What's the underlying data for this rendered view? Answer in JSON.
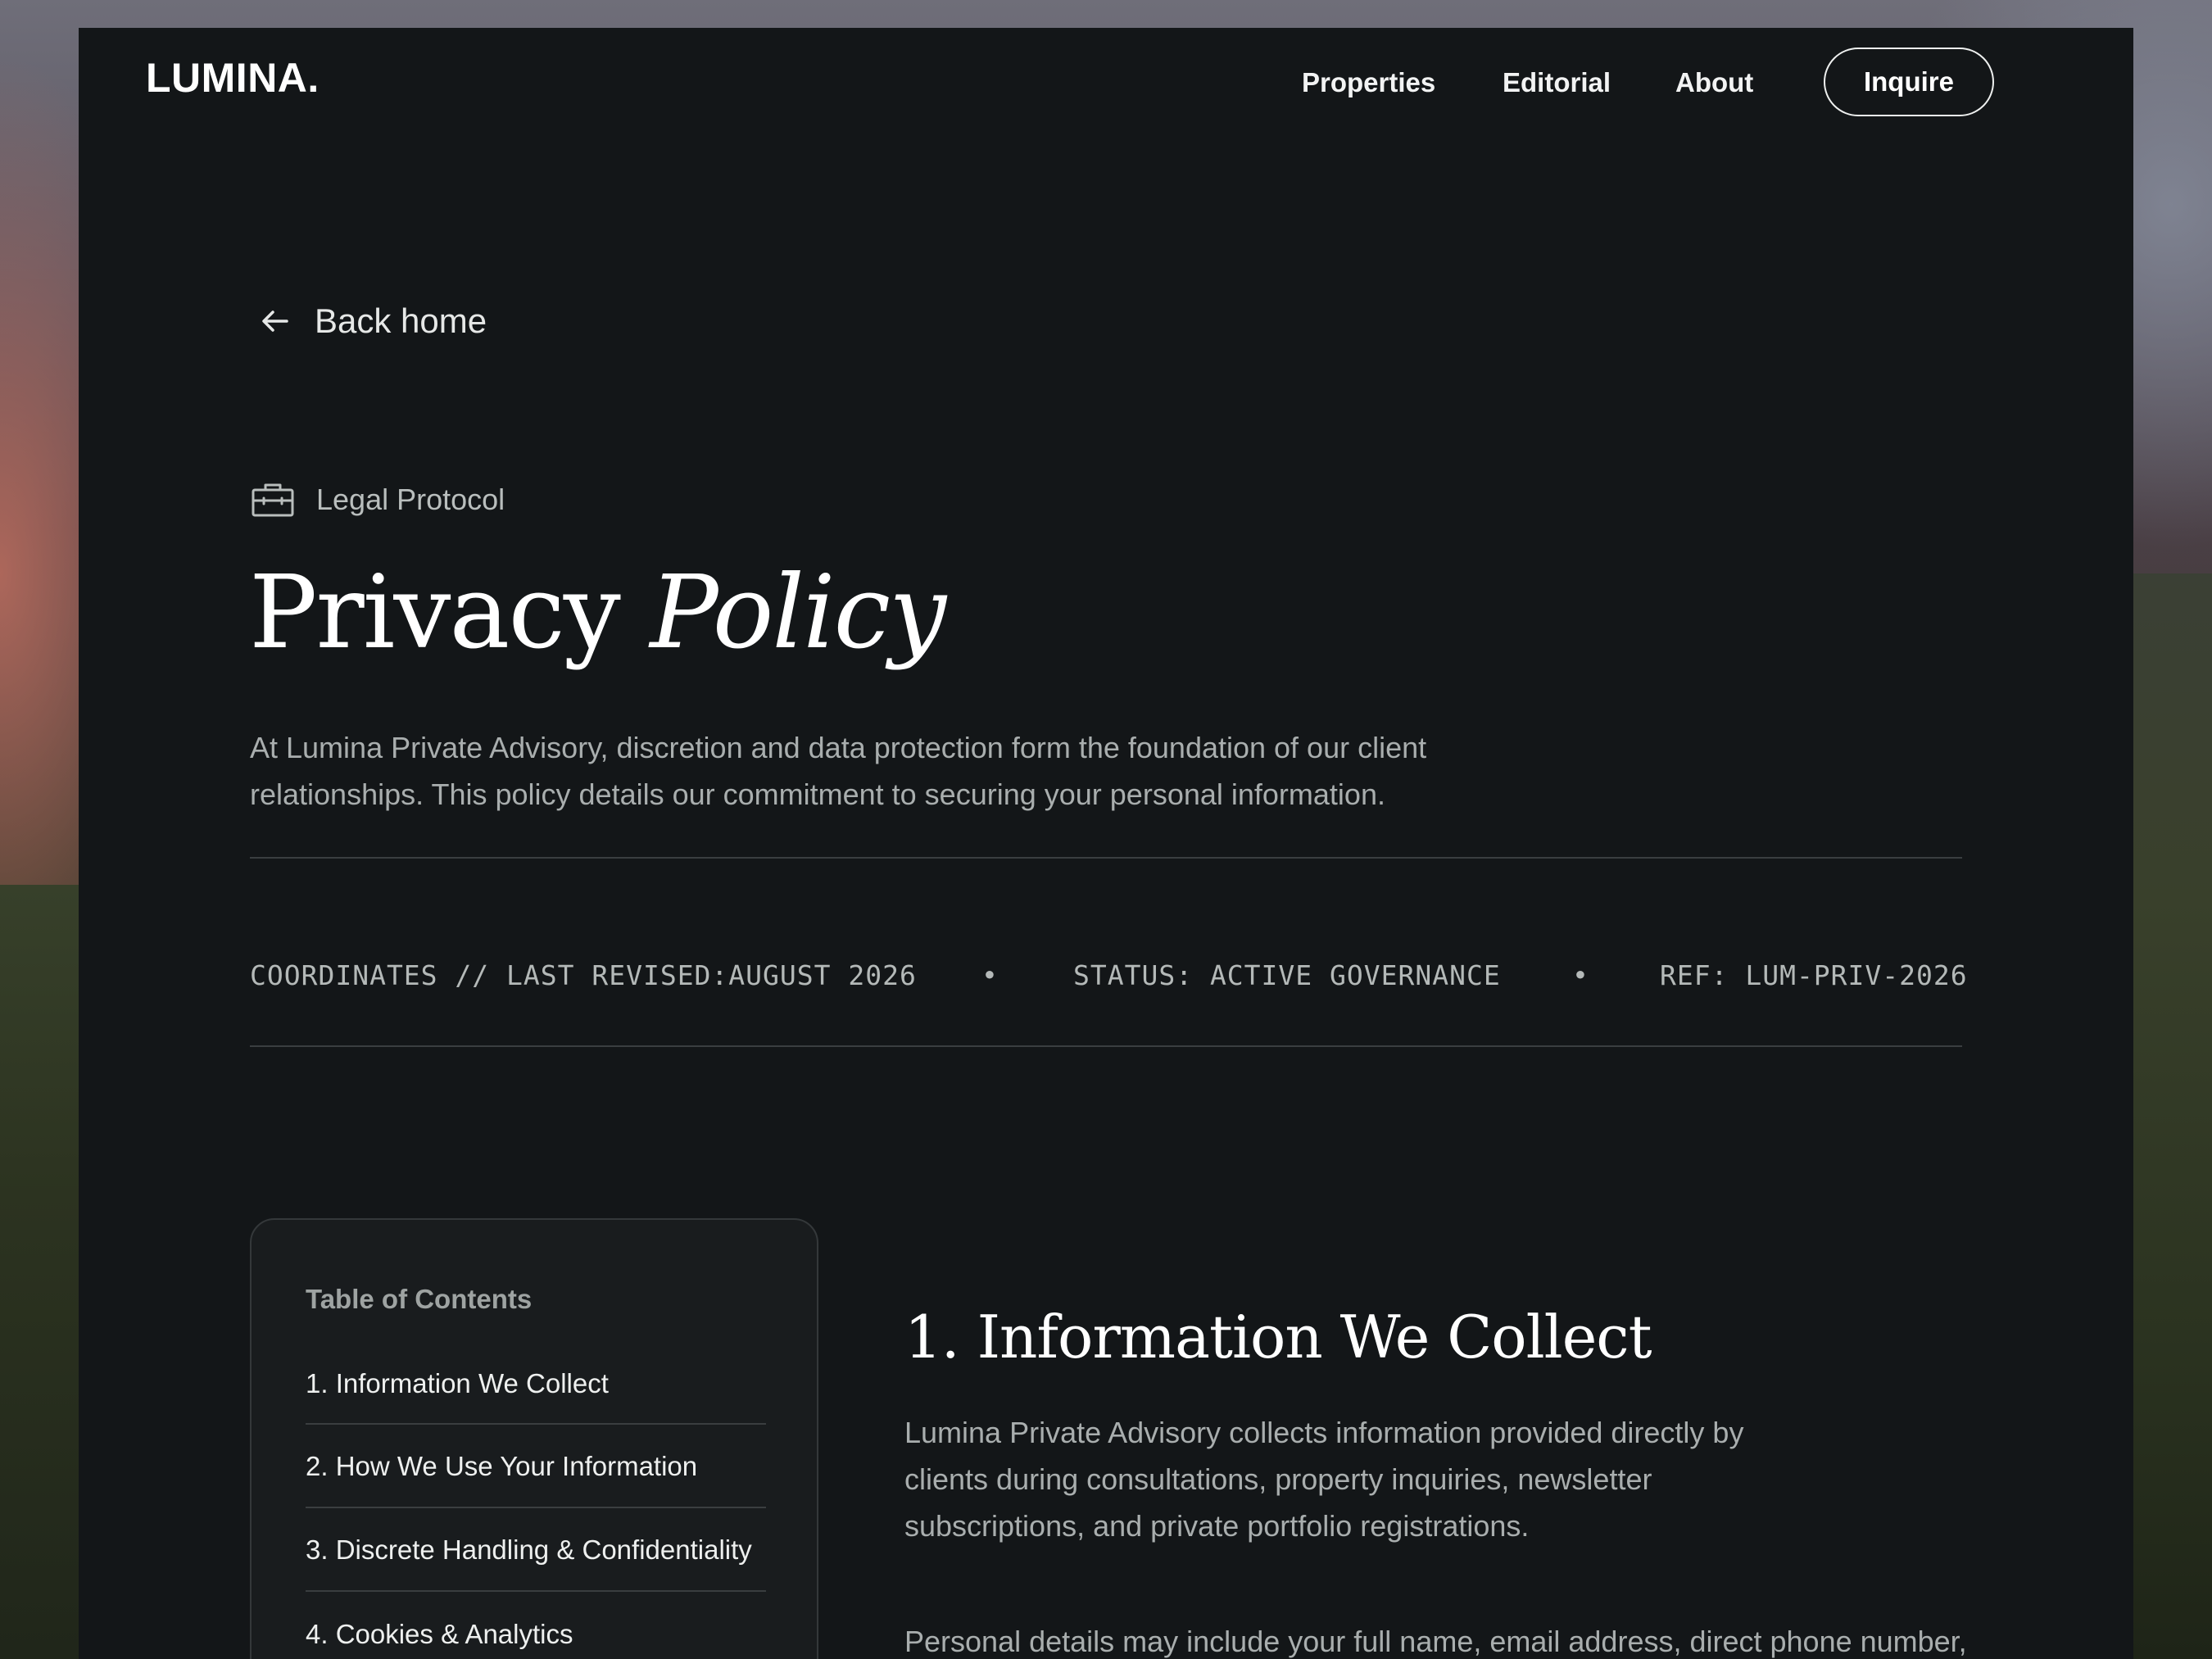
{
  "nav": {
    "logo": "LUMINA.",
    "links": [
      "Properties",
      "Editorial",
      "About"
    ],
    "cta": "Inquire"
  },
  "back": {
    "label": "Back home",
    "icon": "arrow-left-icon"
  },
  "kicker": {
    "label": "Legal Protocol",
    "icon": "briefcase-icon"
  },
  "title": {
    "plain": "Privacy",
    "emphasis": "Policy"
  },
  "intro": "At Lumina Private Advisory, discretion and data protection form the foundation of our client relationships. This policy details our commitment to securing your personal information.",
  "meta": {
    "revised": "COORDINATES // LAST REVISED:AUGUST 2026",
    "separator": "•",
    "status": "STATUS: ACTIVE GOVERNANCE",
    "ref": "REF: LUM-PRIV-2026"
  },
  "toc": {
    "heading": "Table of Contents",
    "items": [
      "1. Information We Collect",
      "2. How We Use Your Information",
      "3. Discrete Handling & Confidentiality",
      "4. Cookies & Analytics"
    ]
  },
  "article": {
    "section_title": "1. Information We Collect",
    "paragraphs": [
      "Lumina Private Advisory collects information provided directly by clients during consultations, property inquiries, newsletter subscriptions, and private portfolio registrations.",
      "Personal details may include your full name, email address, direct phone number, preferred geographic regions, investment criteria, and non-sensitive"
    ]
  },
  "colors": {
    "page_bg": "#131618",
    "text": "#eceeed",
    "muted": "#a9aeae",
    "rule": "#3a3e40"
  }
}
